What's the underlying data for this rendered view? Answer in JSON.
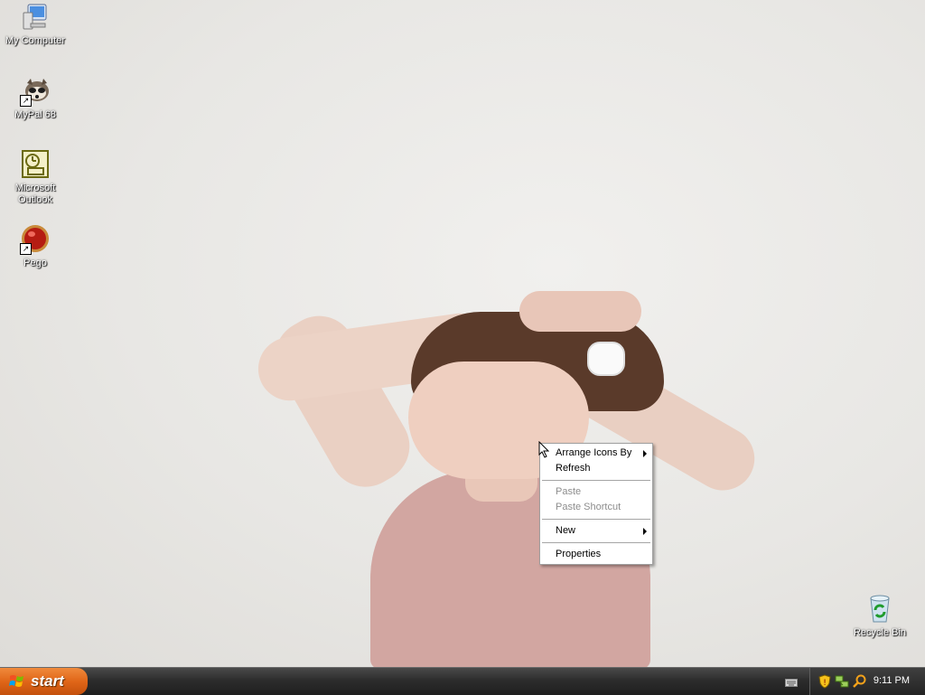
{
  "desktop": {
    "icons": [
      {
        "label": "My Computer",
        "icon": "computer-icon"
      },
      {
        "label": "MyPal 68",
        "icon": "mypal-raccoon-icon"
      },
      {
        "label": "Microsoft\nOutlook",
        "icon": "outlook-icon"
      },
      {
        "label": "Pego",
        "icon": "pego-ball-icon"
      },
      {
        "label": "Recycle Bin",
        "icon": "recycle-bin-icon"
      }
    ]
  },
  "context_menu": {
    "items": [
      {
        "label": "Arrange Icons By",
        "has_submenu": true,
        "enabled": true
      },
      {
        "label": "Refresh",
        "has_submenu": false,
        "enabled": true
      },
      {
        "label": "Paste",
        "has_submenu": false,
        "enabled": false
      },
      {
        "label": "Paste Shortcut",
        "has_submenu": false,
        "enabled": false
      },
      {
        "label": "New",
        "has_submenu": true,
        "enabled": true
      },
      {
        "label": "Properties",
        "has_submenu": false,
        "enabled": true
      }
    ]
  },
  "taskbar": {
    "start_label": "start",
    "clock": "9:11 PM",
    "tray_icons": [
      "keyboard-icon",
      "security-shield-icon",
      "network-icon",
      "search-icon"
    ]
  },
  "colors": {
    "taskbar": "#2d2d2d",
    "start_button": "#e06618",
    "menu_background": "#ffffff",
    "disabled_text": "#8d8d8d"
  }
}
